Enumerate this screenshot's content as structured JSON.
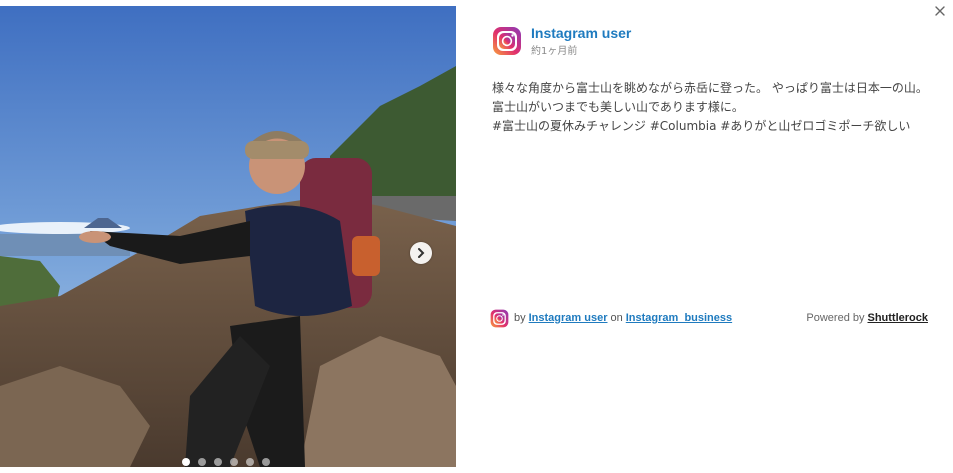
{
  "post": {
    "user_name": "Instagram user",
    "time_ago": "約1ヶ月前",
    "caption": "様々な角度から富士山を眺めながら赤岳に登った。 やっぱり富士は日本一の山。 富士山がいつまでも美しい山であります様に。\n#富士山の夏休みチャレンジ #Columbia #ありがと山ゼロゴミポーチ欲しい"
  },
  "carousel": {
    "dots": [
      "",
      "",
      "",
      "",
      "",
      ""
    ],
    "active_index": 0
  },
  "footer": {
    "by": "by",
    "user_link": "Instagram user",
    "on": "on",
    "account_link": "Instagram_business",
    "powered_by": "Powered by",
    "powered_link": "Shuttlerock"
  },
  "colors": {
    "link": "#1f7bbf",
    "sky": "#5b86c9",
    "rock": "#6e5a48"
  },
  "icons": {
    "close": "close-icon",
    "next": "chevron-right-icon",
    "brand": "instagram-icon"
  }
}
